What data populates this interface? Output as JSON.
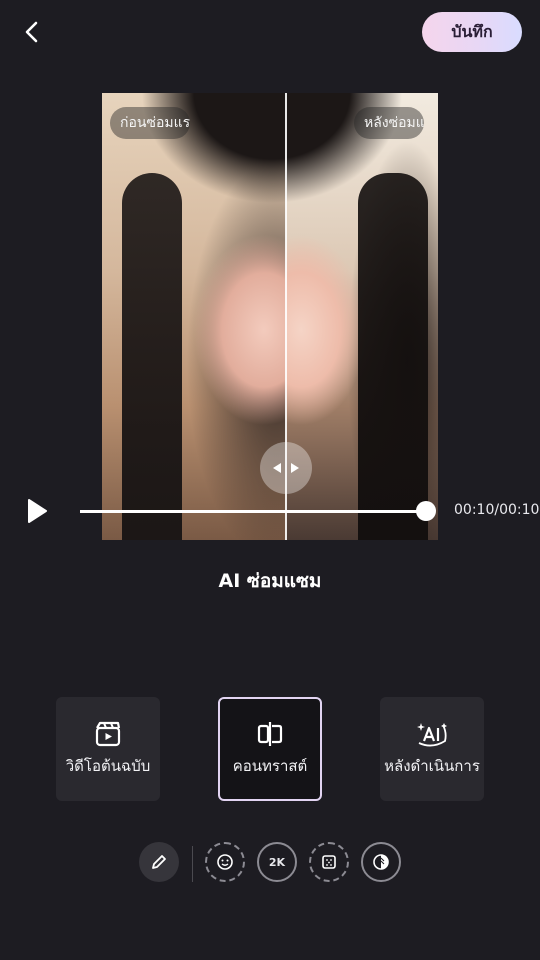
{
  "header": {
    "save_label": "บันทึก",
    "back_icon": "chevron-left-icon"
  },
  "preview": {
    "before_label": "ก่อนซ่อมแร",
    "after_label": "หลังซ่อมแซ"
  },
  "player": {
    "time": "00:10/00:10",
    "progress": 1.0
  },
  "panel": {
    "title": "AI ซ่อมแซม",
    "options": [
      {
        "label": "วิดีโอต้นฉบับ",
        "icon": "video-clapper-icon",
        "selected": false
      },
      {
        "label": "คอนทราสต์",
        "icon": "compare-split-icon",
        "selected": true
      },
      {
        "label": "หลังดำเนินการ",
        "icon": "ai-sparkle-icon",
        "selected": false
      }
    ]
  },
  "toolbar": {
    "tools": [
      {
        "name": "edit-pencil-icon"
      },
      {
        "name": "face-icon"
      },
      {
        "name": "resolution-2k",
        "text": "2K"
      },
      {
        "name": "noise-icon"
      },
      {
        "name": "color-icon"
      }
    ]
  },
  "colors": {
    "background": "#1d1c22",
    "card": "#2a292f",
    "accent_gradient_start": "#f5d5ec",
    "accent_gradient_end": "#d9dcff"
  }
}
